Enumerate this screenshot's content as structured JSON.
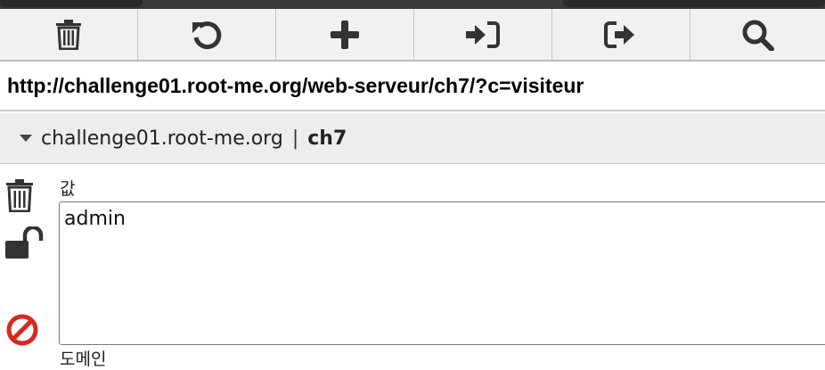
{
  "toolbar": {
    "buttons": [
      {
        "name": "delete-all",
        "icon": "trash-icon"
      },
      {
        "name": "reset",
        "icon": "undo-icon"
      },
      {
        "name": "add",
        "icon": "plus-icon"
      },
      {
        "name": "import",
        "icon": "sign-in-icon"
      },
      {
        "name": "export",
        "icon": "sign-out-icon"
      },
      {
        "name": "search",
        "icon": "search-icon"
      }
    ]
  },
  "url": "http://challenge01.root-me.org/web-serveur/ch7/?c=visiteur",
  "cookie": {
    "domain": "challenge01.root-me.org",
    "separator": "|",
    "name": "ch7",
    "value_label": "값",
    "value": "admin",
    "domain_label": "도메인"
  },
  "colors": {
    "icon": "#333333",
    "block_icon": "#d9291c"
  }
}
